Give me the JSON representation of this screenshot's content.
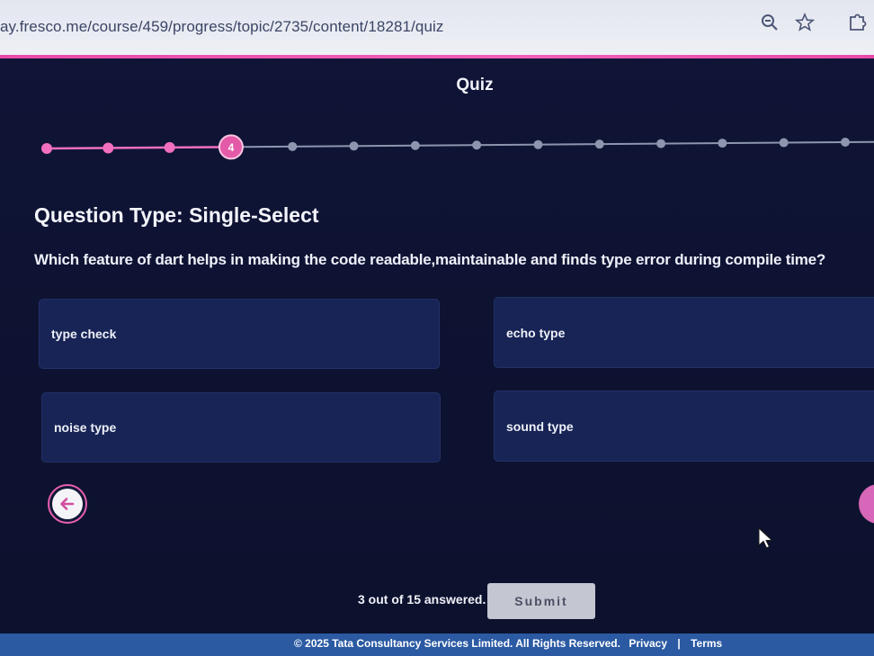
{
  "browser": {
    "url": "ay.fresco.me/course/459/progress/topic/2735/content/18281/quiz",
    "icons": [
      "zoom-icon",
      "star-icon",
      "extension-icon"
    ]
  },
  "quiz": {
    "title": "Quiz",
    "progress": {
      "current_step": "4",
      "total_steps": 14,
      "current_index": 4,
      "colors": {
        "completed": "#f26fc0",
        "pending": "#8d96ae",
        "current_fill": "#e45aa8"
      }
    },
    "question_type": "Question Type: Single-Select",
    "question": "Which feature of dart helps in making the code readable,maintainable and finds type error during compile time?",
    "options": [
      {
        "label": "type check"
      },
      {
        "label": "echo type"
      },
      {
        "label": "noise type"
      },
      {
        "label": "sound type"
      }
    ]
  },
  "footer": {
    "answered": "3 out of 15 answered.",
    "submit_label": "Submit",
    "copyright": "© 2025 Tata Consultancy Services Limited. All Rights Reserved.",
    "privacy": "Privacy",
    "separator": "|",
    "terms": "Terms"
  },
  "colors": {
    "background": "#0e1333",
    "option_bg": "#172455",
    "accent": "#e84aa8",
    "footer": "#2b5aa3"
  }
}
